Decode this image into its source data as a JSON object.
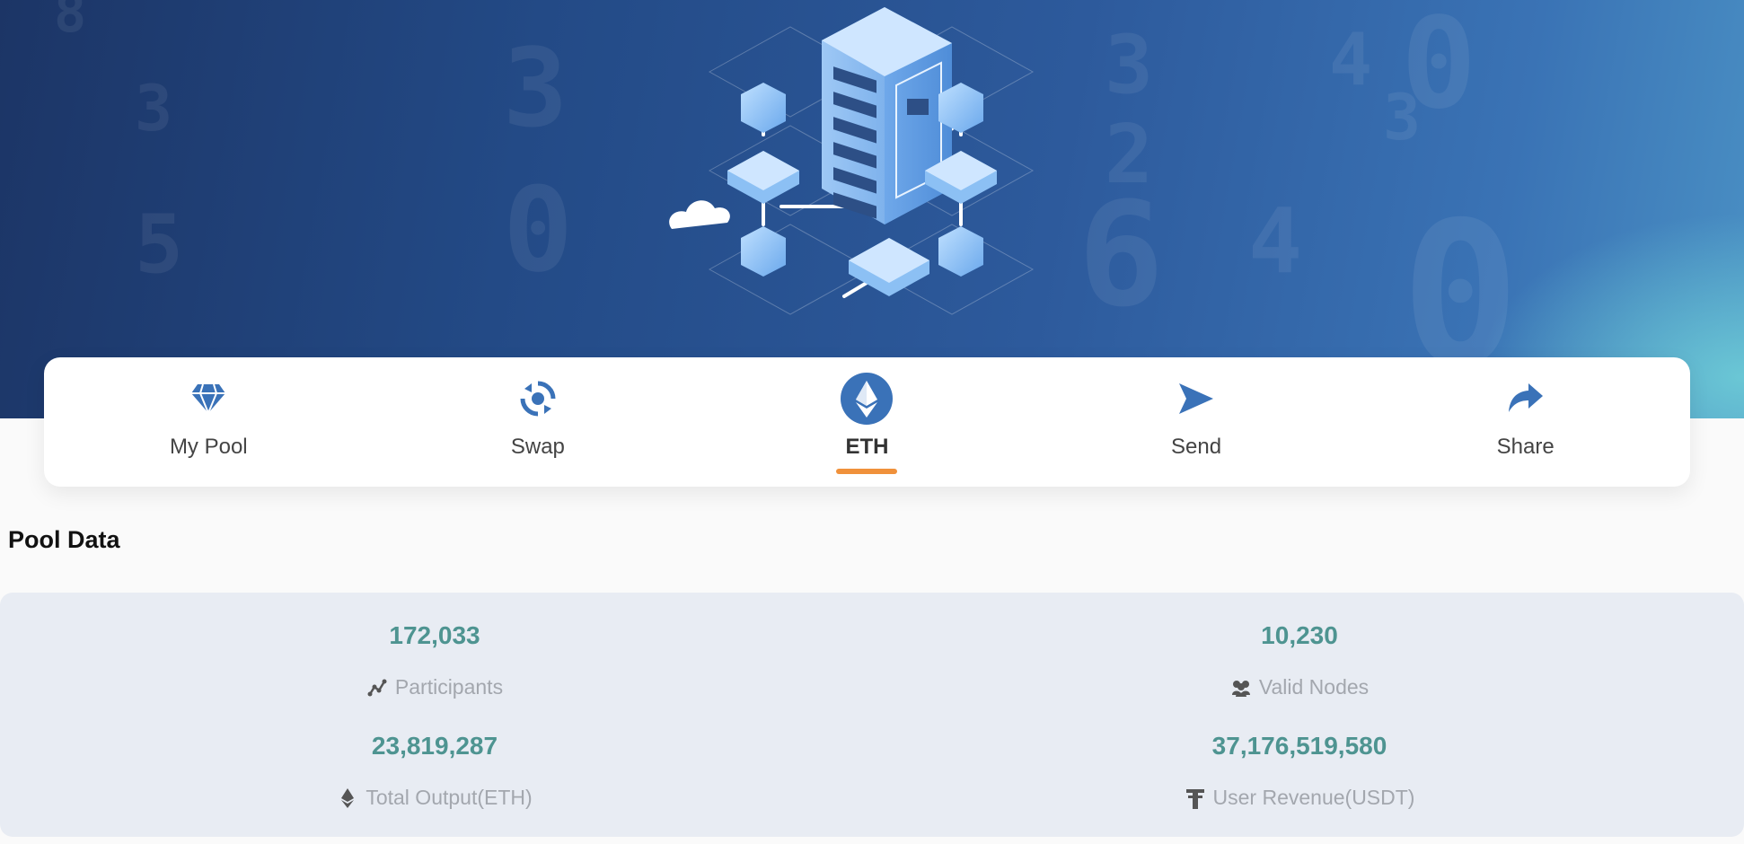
{
  "nav": {
    "items": [
      {
        "label": "My Pool",
        "icon": "diamond-icon"
      },
      {
        "label": "Swap",
        "icon": "swap-cycle-icon"
      },
      {
        "label": "ETH",
        "icon": "ethereum-icon"
      },
      {
        "label": "Send",
        "icon": "send-icon"
      },
      {
        "label": "Share",
        "icon": "share-icon"
      }
    ],
    "active": "ETH",
    "accent_color": "#3a72b8",
    "underline_color": "#f0913b"
  },
  "pool": {
    "title": "Pool Data",
    "stats": [
      {
        "value": "172,033",
        "label": "Participants",
        "icon": "trend-line-icon"
      },
      {
        "value": "10,230",
        "label": "Valid Nodes",
        "icon": "users-icon"
      },
      {
        "value": "23,819,287",
        "label": "Total Output(ETH)",
        "icon": "ethereum-icon"
      },
      {
        "value": "37,176,519,580",
        "label": "User Revenue(USDT)",
        "icon": "tether-icon"
      }
    ],
    "value_color": "#4e9491"
  }
}
